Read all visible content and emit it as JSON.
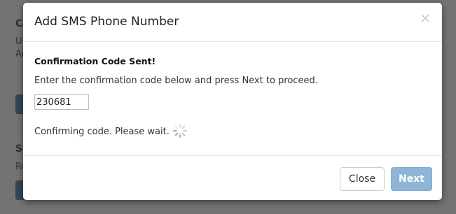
{
  "background": {
    "heading_1": "Co",
    "line_1": "Us",
    "line_2": "Ac",
    "heading_2": "SM",
    "line_3": "Re"
  },
  "modal": {
    "title": "Add SMS Phone Number",
    "close_icon": "close-x-icon",
    "sent_title": "Confirmation Code Sent!",
    "instructions": "Enter the confirmation code below and press Next to proceed.",
    "code_value": "230681",
    "status_text": "Confirming code. Please wait.",
    "spinner_icon": "loading-spinner-icon",
    "close_label": "Close",
    "next_label": "Next"
  },
  "colors": {
    "next_button": "#8eb5d7",
    "background_button": "#2a6fa8"
  }
}
